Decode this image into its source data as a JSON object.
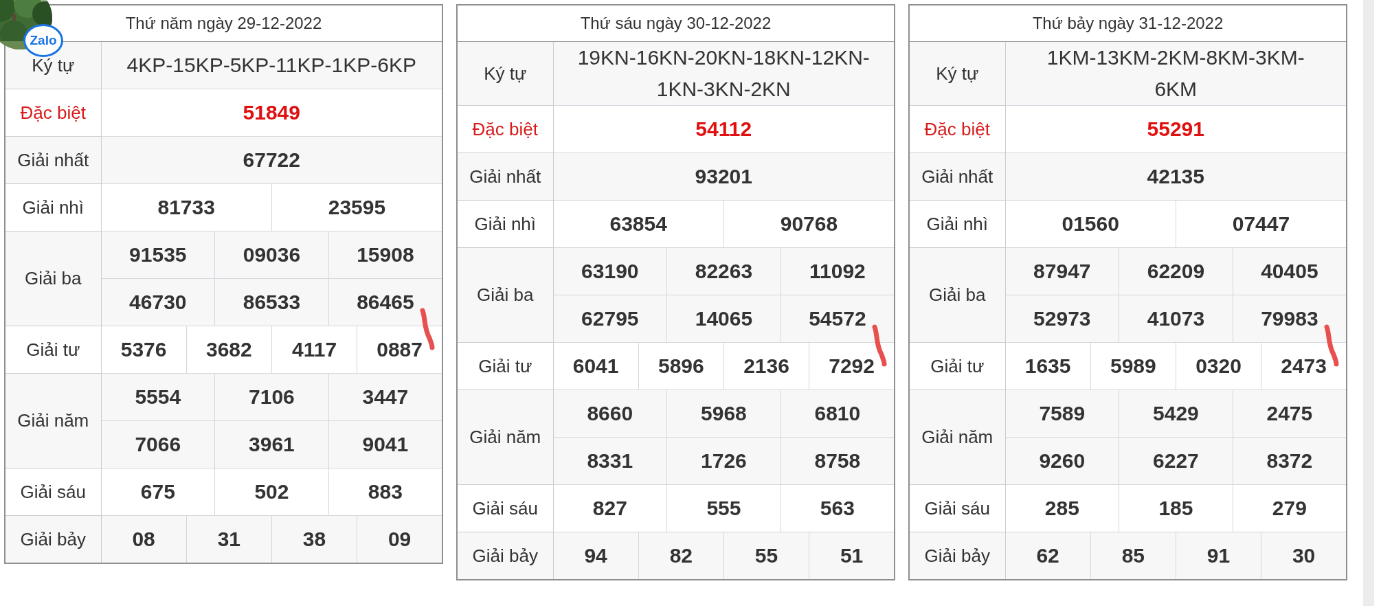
{
  "floating_button": {
    "label": "Zalo"
  },
  "tables": [
    {
      "title": "Thứ năm ngày 29-12-2022",
      "pen_mark": true,
      "rows": [
        {
          "kind": "code",
          "label": "Ký tự",
          "lines": [
            [
              "4KP-15KP-5KP-11KP-1KP-6KP"
            ]
          ]
        },
        {
          "kind": "special",
          "label": "Đặc biệt",
          "lines": [
            [
              "51849"
            ]
          ]
        },
        {
          "kind": "prize",
          "label": "Giải nhất",
          "lines": [
            [
              "67722"
            ]
          ]
        },
        {
          "kind": "prize",
          "label": "Giải nhì",
          "lines": [
            [
              "81733",
              "23595"
            ]
          ]
        },
        {
          "kind": "prize",
          "label": "Giải ba",
          "lines": [
            [
              "91535",
              "09036",
              "15908"
            ],
            [
              "46730",
              "86533",
              "86465"
            ]
          ]
        },
        {
          "kind": "prize",
          "label": "Giải tư",
          "lines": [
            [
              "5376",
              "3682",
              "4117",
              "0887"
            ]
          ]
        },
        {
          "kind": "prize",
          "label": "Giải năm",
          "lines": [
            [
              "5554",
              "7106",
              "3447"
            ],
            [
              "7066",
              "3961",
              "9041"
            ]
          ]
        },
        {
          "kind": "prize",
          "label": "Giải sáu",
          "lines": [
            [
              "675",
              "502",
              "883"
            ]
          ]
        },
        {
          "kind": "prize",
          "label": "Giải bảy",
          "lines": [
            [
              "08",
              "31",
              "38",
              "09"
            ]
          ]
        }
      ]
    },
    {
      "title": "Thứ sáu ngày 30-12-2022",
      "pen_mark": true,
      "rows": [
        {
          "kind": "code",
          "label": "Ký tự",
          "lines": [
            [
              "19KN-16KN-20KN-18KN-12KN-1KN-3KN-2KN"
            ]
          ]
        },
        {
          "kind": "special",
          "label": "Đặc biệt",
          "lines": [
            [
              "54112"
            ]
          ]
        },
        {
          "kind": "prize",
          "label": "Giải nhất",
          "lines": [
            [
              "93201"
            ]
          ]
        },
        {
          "kind": "prize",
          "label": "Giải nhì",
          "lines": [
            [
              "63854",
              "90768"
            ]
          ]
        },
        {
          "kind": "prize",
          "label": "Giải ba",
          "lines": [
            [
              "63190",
              "82263",
              "11092"
            ],
            [
              "62795",
              "14065",
              "54572"
            ]
          ]
        },
        {
          "kind": "prize",
          "label": "Giải tư",
          "lines": [
            [
              "6041",
              "5896",
              "2136",
              "7292"
            ]
          ]
        },
        {
          "kind": "prize",
          "label": "Giải năm",
          "lines": [
            [
              "8660",
              "5968",
              "6810"
            ],
            [
              "8331",
              "1726",
              "8758"
            ]
          ]
        },
        {
          "kind": "prize",
          "label": "Giải sáu",
          "lines": [
            [
              "827",
              "555",
              "563"
            ]
          ]
        },
        {
          "kind": "prize",
          "label": "Giải bảy",
          "lines": [
            [
              "94",
              "82",
              "55",
              "51"
            ]
          ]
        }
      ]
    },
    {
      "title": "Thứ bảy ngày 31-12-2022",
      "pen_mark": true,
      "rows": [
        {
          "kind": "code",
          "label": "Ký tự",
          "lines": [
            [
              "1KM-13KM-2KM-8KM-3KM-6KM"
            ]
          ]
        },
        {
          "kind": "special",
          "label": "Đặc biệt",
          "lines": [
            [
              "55291"
            ]
          ]
        },
        {
          "kind": "prize",
          "label": "Giải nhất",
          "lines": [
            [
              "42135"
            ]
          ]
        },
        {
          "kind": "prize",
          "label": "Giải nhì",
          "lines": [
            [
              "01560",
              "07447"
            ]
          ]
        },
        {
          "kind": "prize",
          "label": "Giải ba",
          "lines": [
            [
              "87947",
              "62209",
              "40405"
            ],
            [
              "52973",
              "41073",
              "79983"
            ]
          ]
        },
        {
          "kind": "prize",
          "label": "Giải tư",
          "lines": [
            [
              "1635",
              "5989",
              "0320",
              "2473"
            ]
          ]
        },
        {
          "kind": "prize",
          "label": "Giải năm",
          "lines": [
            [
              "7589",
              "5429",
              "2475"
            ],
            [
              "9260",
              "6227",
              "8372"
            ]
          ]
        },
        {
          "kind": "prize",
          "label": "Giải sáu",
          "lines": [
            [
              "285",
              "185",
              "279"
            ]
          ]
        },
        {
          "kind": "prize",
          "label": "Giải bảy",
          "lines": [
            [
              "62",
              "85",
              "91",
              "30"
            ]
          ]
        }
      ]
    }
  ]
}
